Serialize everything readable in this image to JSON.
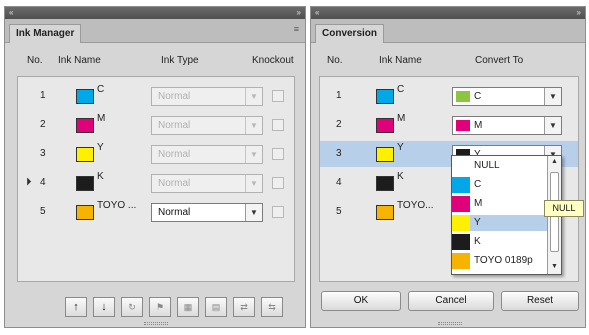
{
  "ink_manager": {
    "title_left": "«",
    "title_right": "»",
    "tab": "Ink Manager",
    "menu_icon": "≡",
    "headers": {
      "no": "No.",
      "ink_name": "Ink Name",
      "ink_type": "Ink Type",
      "knockout": "Knockout"
    },
    "rows": [
      {
        "no": "1",
        "name": "C",
        "swatch": "#00a8e8",
        "type": "Normal",
        "enabled": false,
        "marker": ""
      },
      {
        "no": "2",
        "name": "M",
        "swatch": "#e0007a",
        "type": "Normal",
        "enabled": false,
        "marker": ""
      },
      {
        "no": "3",
        "name": "Y",
        "swatch": "#ffef00",
        "type": "Normal",
        "enabled": false,
        "marker": ""
      },
      {
        "no": "4",
        "name": "K",
        "swatch": "#1c1c1c",
        "type": "Normal",
        "enabled": false,
        "marker": "⏵"
      },
      {
        "no": "5",
        "name": "TOYO ...",
        "swatch": "#f6b400",
        "type": "Normal",
        "enabled": true,
        "marker": ""
      }
    ],
    "toolbar": [
      "↑",
      "↓",
      "↻",
      "⚑",
      "▦",
      "▤",
      "⇄",
      "⇆"
    ]
  },
  "conversion": {
    "title_left": "«",
    "title_right": "»",
    "tab": "Conversion",
    "headers": {
      "no": "No.",
      "ink_name": "Ink Name",
      "convert_to": "Convert To"
    },
    "rows": [
      {
        "no": "1",
        "name": "C",
        "swatch": "#00a8e8",
        "convert": "C",
        "convert_swatch": "#8cc63f"
      },
      {
        "no": "2",
        "name": "M",
        "swatch": "#e0007a",
        "convert": "M",
        "convert_swatch": "#e0007a"
      },
      {
        "no": "3",
        "name": "Y",
        "swatch": "#ffef00",
        "convert": "Y",
        "convert_swatch": "#1c1c1c"
      },
      {
        "no": "4",
        "name": "K",
        "swatch": "#1c1c1c"
      },
      {
        "no": "5",
        "name": "TOYO...",
        "swatch": "#f6b400"
      }
    ],
    "buttons": {
      "ok": "OK",
      "cancel": "Cancel",
      "reset": "Reset"
    },
    "dropdown_options": [
      {
        "label": "NULL",
        "swatch": ""
      },
      {
        "label": "C",
        "swatch": "#00a8e8"
      },
      {
        "label": "M",
        "swatch": "#e0007a"
      },
      {
        "label": "Y",
        "swatch": "#ffef00"
      },
      {
        "label": "K",
        "swatch": "#1c1c1c"
      },
      {
        "label": "TOYO 0189p",
        "swatch": "#f6b400"
      }
    ],
    "highlighted_option": "Y",
    "tooltip": "NULL"
  },
  "colors": {
    "selected_row": "#b8cfea",
    "panel_bg": "#d6d6d6"
  },
  "icons": {
    "dropdown_arrow": "▼",
    "scroll_up": "▲",
    "scroll_down": "▼"
  }
}
